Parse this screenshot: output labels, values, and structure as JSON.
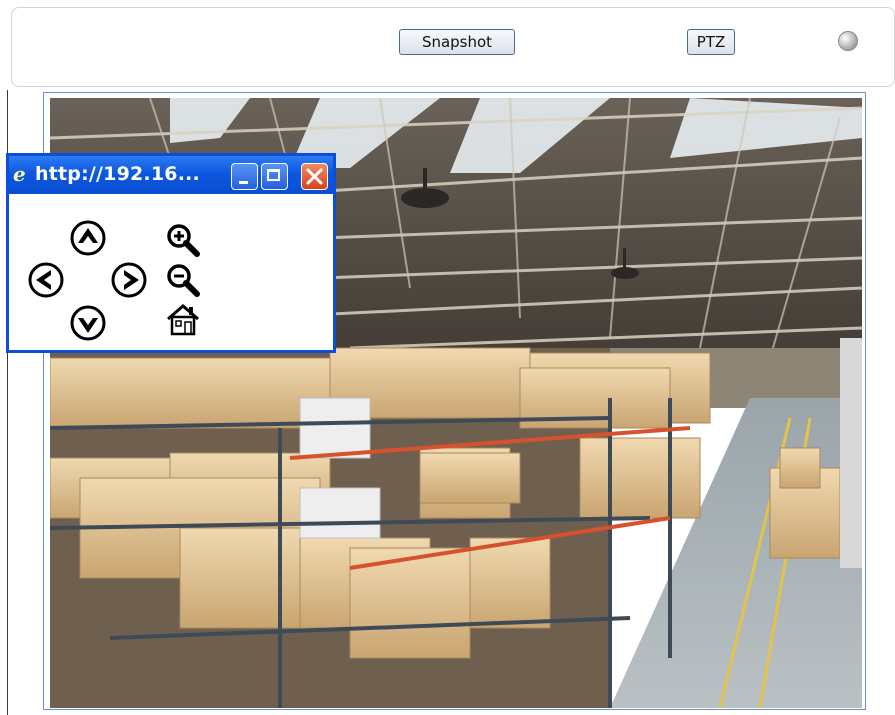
{
  "toolbar": {
    "snapshot_label": "Snapshot",
    "ptz_label": "PTZ",
    "status_indicator_color": "#9a9a9a"
  },
  "popup": {
    "title": "http://192.16...",
    "browser_icon": "ie-icon",
    "window_buttons": [
      "minimize-icon",
      "maximize-icon",
      "close-icon"
    ],
    "controls": [
      "pan-up-icon",
      "pan-left-icon",
      "pan-right-icon",
      "pan-down-icon",
      "zoom-in-icon",
      "zoom-out-icon",
      "home-icon"
    ]
  },
  "video": {
    "content": "camera-feed",
    "frame_border_color": "#6b8fc7"
  },
  "colors": {
    "titlebar_blue": "#0c58e0",
    "close_red": "#d6411d"
  }
}
